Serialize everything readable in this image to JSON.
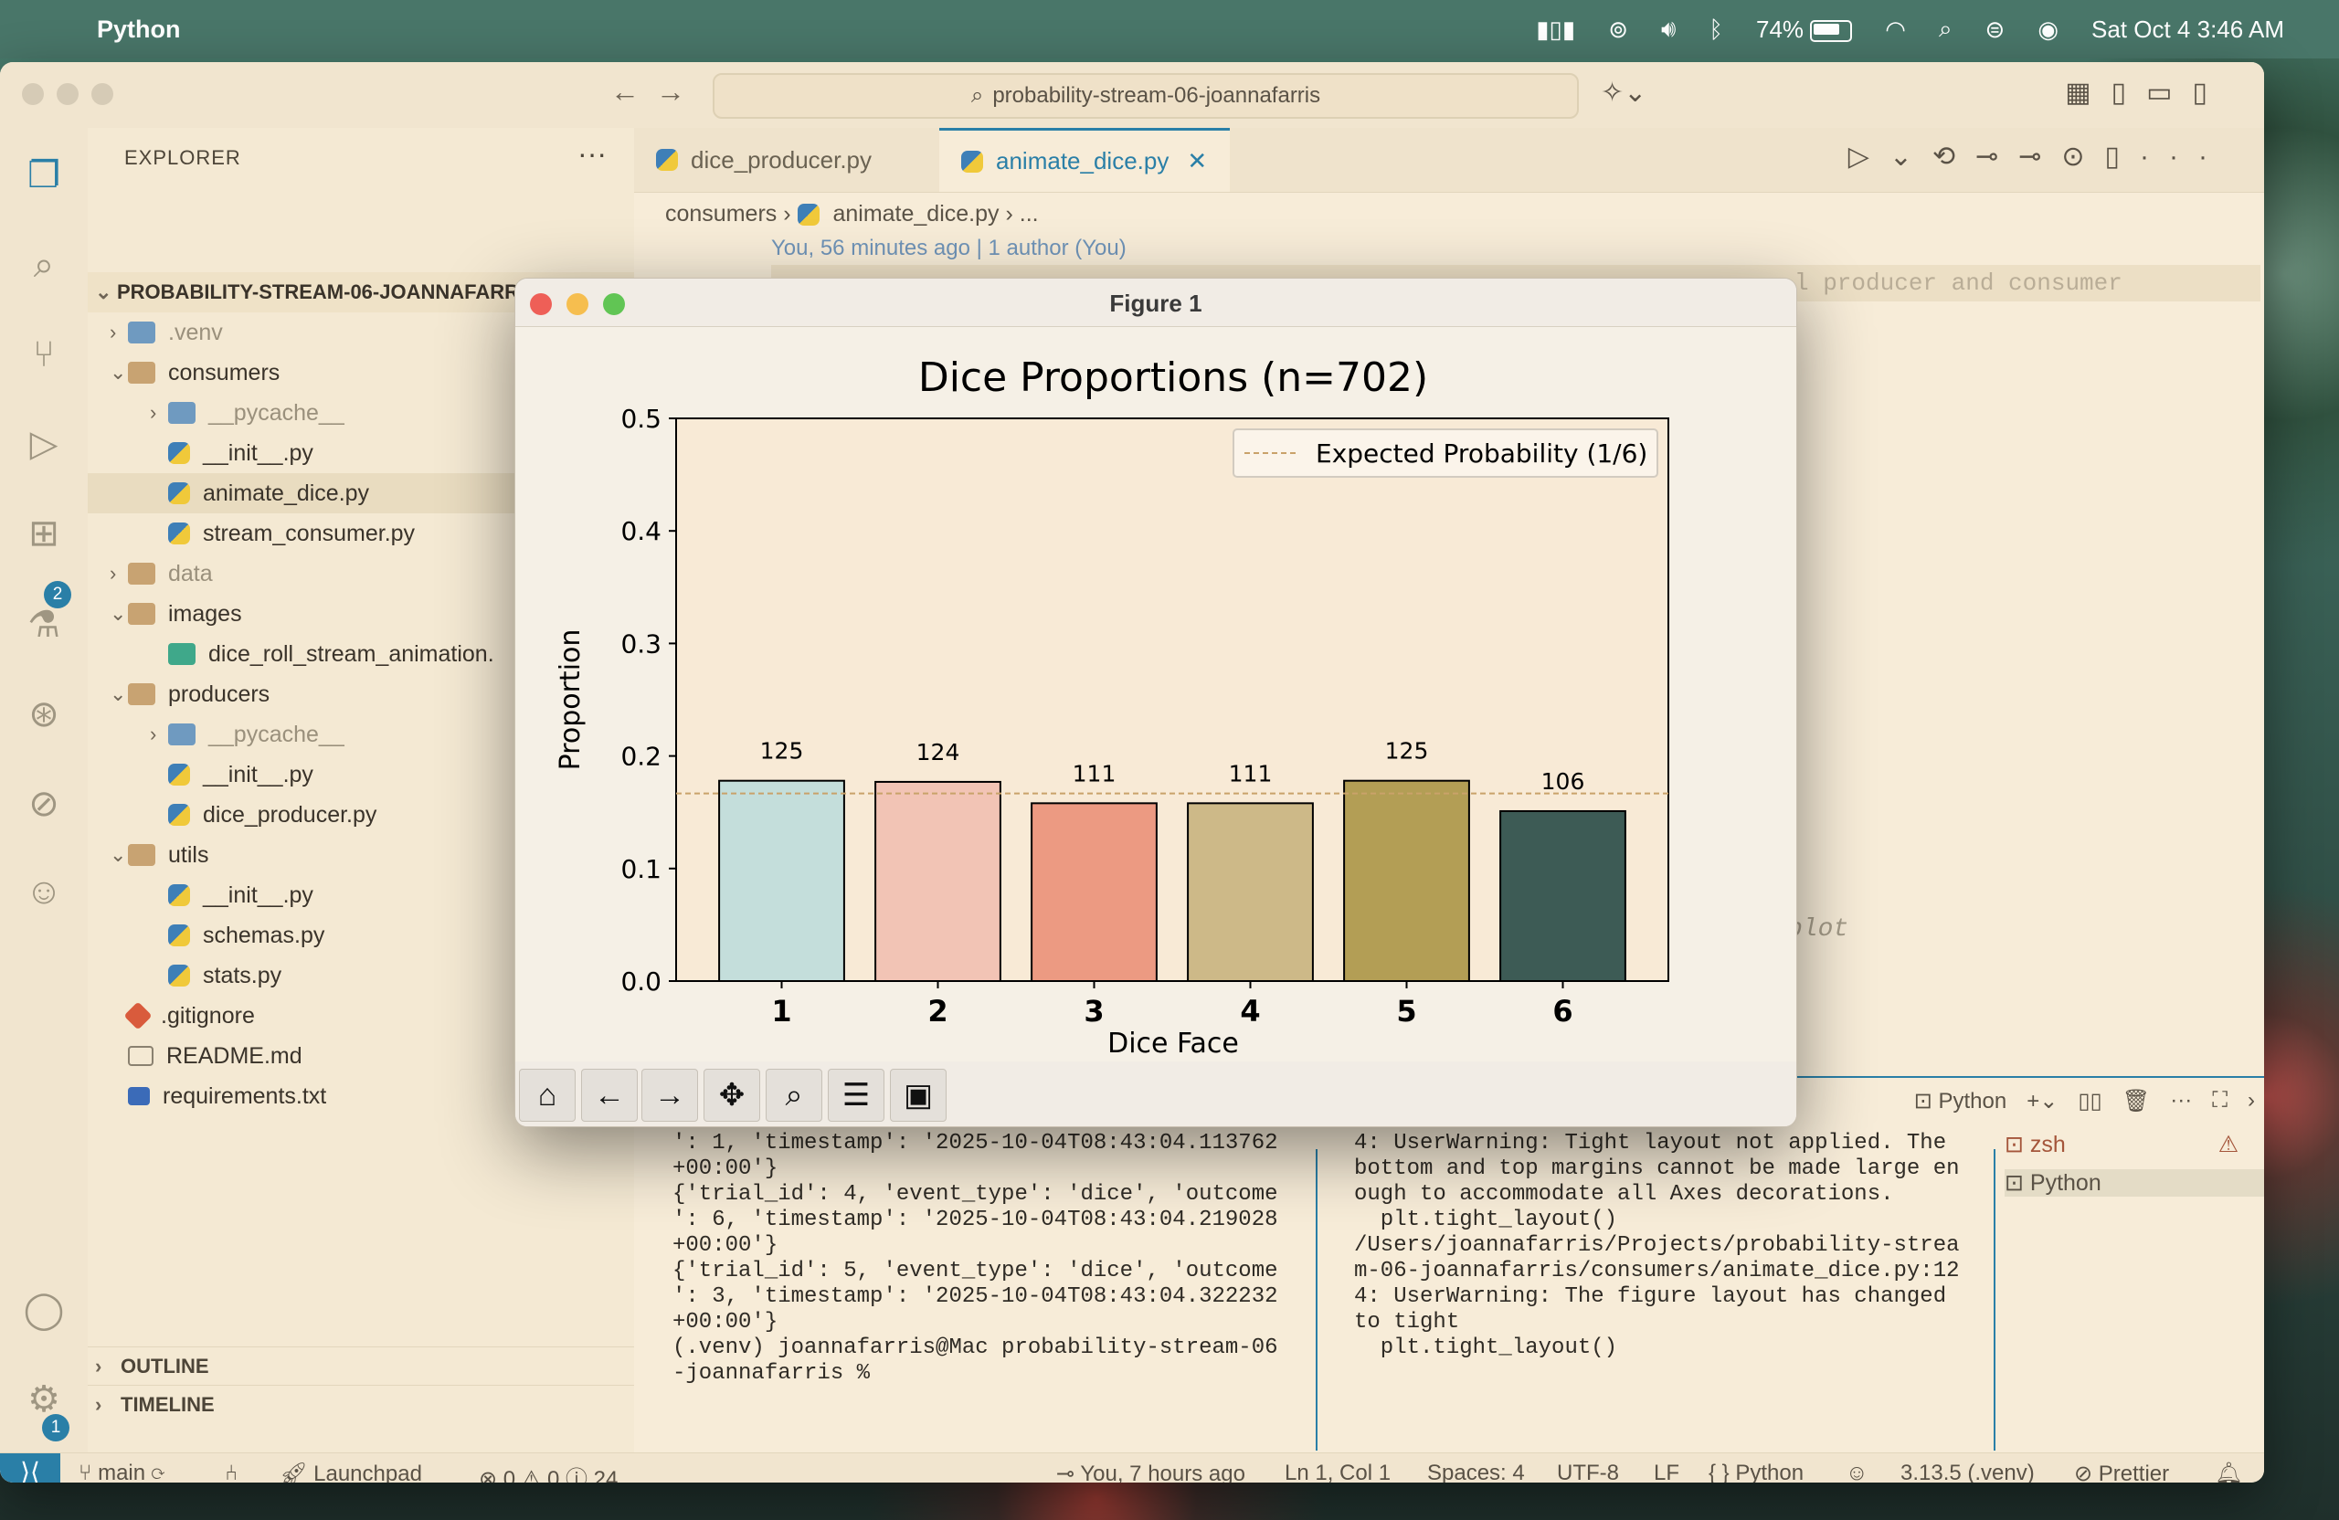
{
  "menubar": {
    "app_name": "Python",
    "battery": "74%",
    "datetime": "Sat Oct 4  3:46 AM"
  },
  "vscode": {
    "command_center": "probability-stream-06-joannafarris",
    "sidebar": {
      "title": "EXPLORER",
      "root": "PROBABILITY-STREAM-06-JOANNAFARRIS",
      "items": [
        {
          "label": ".venv",
          "depth": 1,
          "kind": "folder-py",
          "chevron": "›",
          "dim": true
        },
        {
          "label": "consumers",
          "depth": 1,
          "kind": "folder",
          "chevron": "⌄"
        },
        {
          "label": "__pycache__",
          "depth": 2,
          "kind": "folder-py",
          "chevron": "›",
          "dim": true
        },
        {
          "label": "__init__.py",
          "depth": 2,
          "kind": "py"
        },
        {
          "label": "animate_dice.py",
          "depth": 2,
          "kind": "py",
          "selected": true
        },
        {
          "label": "stream_consumer.py",
          "depth": 2,
          "kind": "py"
        },
        {
          "label": "data",
          "depth": 1,
          "kind": "folder",
          "chevron": "›",
          "dim": true
        },
        {
          "label": "images",
          "depth": 1,
          "kind": "folder-img",
          "chevron": "⌄"
        },
        {
          "label": "dice_roll_stream_animation.",
          "depth": 2,
          "kind": "img"
        },
        {
          "label": "producers",
          "depth": 1,
          "kind": "folder",
          "chevron": "⌄"
        },
        {
          "label": "__pycache__",
          "depth": 2,
          "kind": "folder-py",
          "chevron": "›",
          "dim": true
        },
        {
          "label": "__init__.py",
          "depth": 2,
          "kind": "py"
        },
        {
          "label": "dice_producer.py",
          "depth": 2,
          "kind": "py"
        },
        {
          "label": "utils",
          "depth": 1,
          "kind": "folder",
          "chevron": "⌄"
        },
        {
          "label": "__init__.py",
          "depth": 2,
          "kind": "py"
        },
        {
          "label": "schemas.py",
          "depth": 2,
          "kind": "py"
        },
        {
          "label": "stats.py",
          "depth": 2,
          "kind": "py"
        },
        {
          "label": ".gitignore",
          "depth": 1,
          "kind": "git"
        },
        {
          "label": "README.md",
          "depth": 1,
          "kind": "md"
        },
        {
          "label": "requirements.txt",
          "depth": 1,
          "kind": "req"
        }
      ],
      "outline": "OUTLINE",
      "timeline": "TIMELINE"
    },
    "activity_badges": {
      "extensions": "2",
      "settings": "1"
    },
    "tabs": [
      {
        "label": "dice_producer.py"
      },
      {
        "label": "animate_dice.py",
        "active": true
      }
    ],
    "breadcrumb": {
      "folder": "consumers",
      "file": "animate_dice.py",
      "rest": "..."
    },
    "blame": "You, 56 minutes ago | 1 author (You)",
    "code_line_tail": "l producer and consumer",
    "code_ghost": "plot",
    "terminal": {
      "profile_label": "Python",
      "left_text": "': 1, 'timestamp': '2025-10-04T08:43:04.113762\n+00:00'}\n{'trial_id': 4, 'event_type': 'dice', 'outcome\n': 6, 'timestamp': '2025-10-04T08:43:04.219028\n+00:00'}\n{'trial_id': 5, 'event_type': 'dice', 'outcome\n': 3, 'timestamp': '2025-10-04T08:43:04.322232\n+00:00'}\n(.venv) joannafarris@Mac probability-stream-06\n-joannafarris % ",
      "right_text": "4: UserWarning: Tight layout not applied. The\nbottom and top margins cannot be made large en\nough to accommodate all Axes decorations.\n  plt.tight_layout()\n/Users/joannafarris/Projects/probability-strea\nm-06-joannafarris/consumers/animate_dice.py:12\n4: UserWarning: The figure layout has changed\nto tight\n  plt.tight_layout()\n",
      "sessions": [
        {
          "label": "zsh",
          "warn": "⚠"
        },
        {
          "label": "Python",
          "selected": true
        }
      ]
    },
    "status": {
      "branch": "main",
      "launchpad": "Launchpad",
      "problems": "⊗ 0 ⚠ 0 ⓘ 24",
      "blame": "You, 7 hours ago",
      "position": "Ln 1, Col 1",
      "spaces": "Spaces: 4",
      "encoding": "UTF-8",
      "eol": "LF",
      "language": "{ } Python",
      "interpreter": "3.13.5 (.venv)",
      "formatter": "Prettier"
    }
  },
  "figure": {
    "window_title": "Figure 1"
  },
  "chart_data": {
    "type": "bar",
    "title": "Dice Proportions (n=702)",
    "xlabel": "Dice Face",
    "ylabel": "Proportion",
    "categories": [
      "1",
      "2",
      "3",
      "4",
      "5",
      "6"
    ],
    "values": [
      0.178,
      0.177,
      0.158,
      0.158,
      0.178,
      0.151
    ],
    "bar_labels": [
      "125",
      "124",
      "111",
      "111",
      "125",
      "106"
    ],
    "colors": [
      "#c4dedb",
      "#f2c4b5",
      "#ec9a82",
      "#cdb988",
      "#b39e55",
      "#3d5b55"
    ],
    "ylim": [
      0,
      0.5
    ],
    "yticks": [
      "0.0",
      "0.1",
      "0.2",
      "0.3",
      "0.4",
      "0.5"
    ],
    "reference_line": {
      "value": 0.1667,
      "label": "Expected Probability (1/6)",
      "color": "#c9a26a"
    },
    "legend_position": "top-right",
    "grid": false,
    "axes_background": "#f8ead6"
  }
}
